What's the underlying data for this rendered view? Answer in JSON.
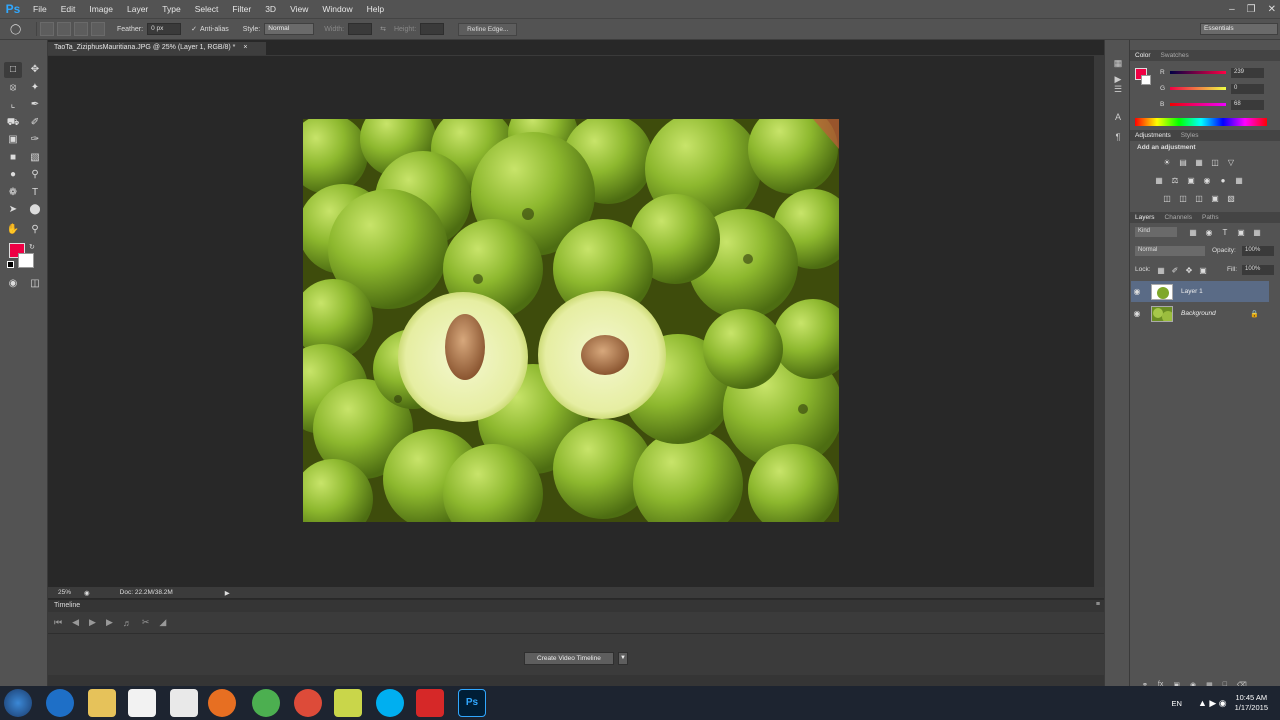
{
  "app": {
    "logo": "Ps",
    "menu": [
      "File",
      "Edit",
      "Image",
      "Layer",
      "Type",
      "Select",
      "Filter",
      "3D",
      "View",
      "Window",
      "Help"
    ],
    "workspace": "Essentials"
  },
  "options": {
    "feather_label": "Feather:",
    "feather_value": "0 px",
    "antialias_label": "Anti-alias",
    "style_label": "Style:",
    "style_value": "Normal",
    "width_label": "Width:",
    "height_label": "Height:",
    "refine_edge": "Refine Edge..."
  },
  "document": {
    "tab_title": "TaoTa_ZiziphusMauritiana.JPG @ 25% (Layer 1, RGB/8) *",
    "zoom": "25%",
    "doc_info": "Doc: 22.2M/38.2M"
  },
  "timeline": {
    "title": "Timeline",
    "create_button": "Create Video Timeline"
  },
  "color_panel": {
    "tabs": [
      "Color",
      "Swatches"
    ],
    "channels": [
      {
        "label": "R",
        "value": "239"
      },
      {
        "label": "G",
        "value": "0"
      },
      {
        "label": "B",
        "value": "68"
      }
    ],
    "foreground": "#ef0044",
    "background": "#ffffff"
  },
  "adjustments_panel": {
    "tabs": [
      "Adjustments",
      "Styles"
    ],
    "heading": "Add an adjustment"
  },
  "layers_panel": {
    "tabs": [
      "Layers",
      "Channels",
      "Paths"
    ],
    "kind": "Kind",
    "blend_mode": "Normal",
    "opacity_label": "Opacity:",
    "opacity_value": "100%",
    "lock_label": "Lock:",
    "fill_label": "Fill:",
    "fill_value": "100%",
    "layers": [
      {
        "name": "Layer 1",
        "selected": true
      },
      {
        "name": "Background",
        "selected": false,
        "locked": true
      }
    ]
  },
  "taskbar": {
    "language": "EN",
    "time": "10:45 AM",
    "date": "1/17/2015"
  },
  "colors": {
    "panel_bg": "#535353",
    "canvas_bg": "#282828",
    "selected_layer": "#5a6b86",
    "accent": "#31a8ff"
  }
}
